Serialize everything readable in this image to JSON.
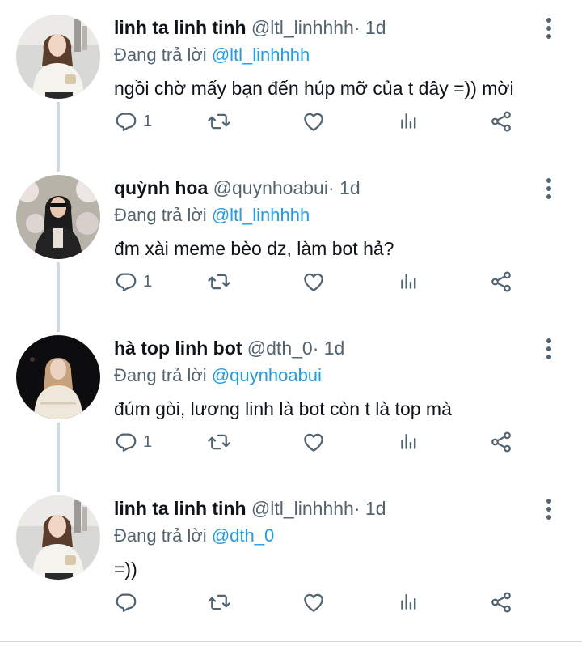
{
  "tweets": [
    {
      "name": "linh ta linh tinh",
      "handle": "@ltl_linhhhh",
      "separator": "·",
      "time": "1d",
      "reply_prefix": "Đang trả lời",
      "reply_to": "@ltl_linhhhh",
      "text": "ngồi chờ mấy bạn đến húp mỡ của t đây =)) mời",
      "reply_count": "1",
      "avatar": "woman-white-sweater-avatar"
    },
    {
      "name": "quỳnh hoa",
      "handle": "@quynhoabui",
      "separator": "·",
      "time": "1d",
      "reply_prefix": "Đang trả lời",
      "reply_to": "@ltl_linhhhh",
      "text": "đm xài meme bèo dz, làm bot hả?",
      "reply_count": "1",
      "avatar": "woman-sunglasses-blossoms-avatar"
    },
    {
      "name": "hà top linh bot",
      "handle": "@dth_0",
      "separator": "·",
      "time": "1d",
      "reply_prefix": "Đang trả lời",
      "reply_to": "@quynhoabui",
      "text": "đúm gòi, lương linh là bot còn t là top mà",
      "reply_count": "1",
      "avatar": "woman-night-avatar"
    },
    {
      "name": "linh ta linh tinh",
      "handle": "@ltl_linhhhh",
      "separator": "·",
      "time": "1d",
      "reply_prefix": "Đang trả lời",
      "reply_to": "@dth_0",
      "text": "=))",
      "reply_count": "",
      "avatar": "woman-white-sweater-avatar"
    }
  ],
  "icons": {
    "reply": "reply-icon",
    "retweet": "retweet-icon",
    "like": "heart-icon",
    "analytics": "analytics-icon",
    "share": "share-icon",
    "more": "more-vertical-icon"
  },
  "colors": {
    "accent": "#1d9bf0",
    "secondary_text": "#536471",
    "primary_text": "#0f1419",
    "icon": "#536471",
    "thread_line": "#cfd9de"
  }
}
